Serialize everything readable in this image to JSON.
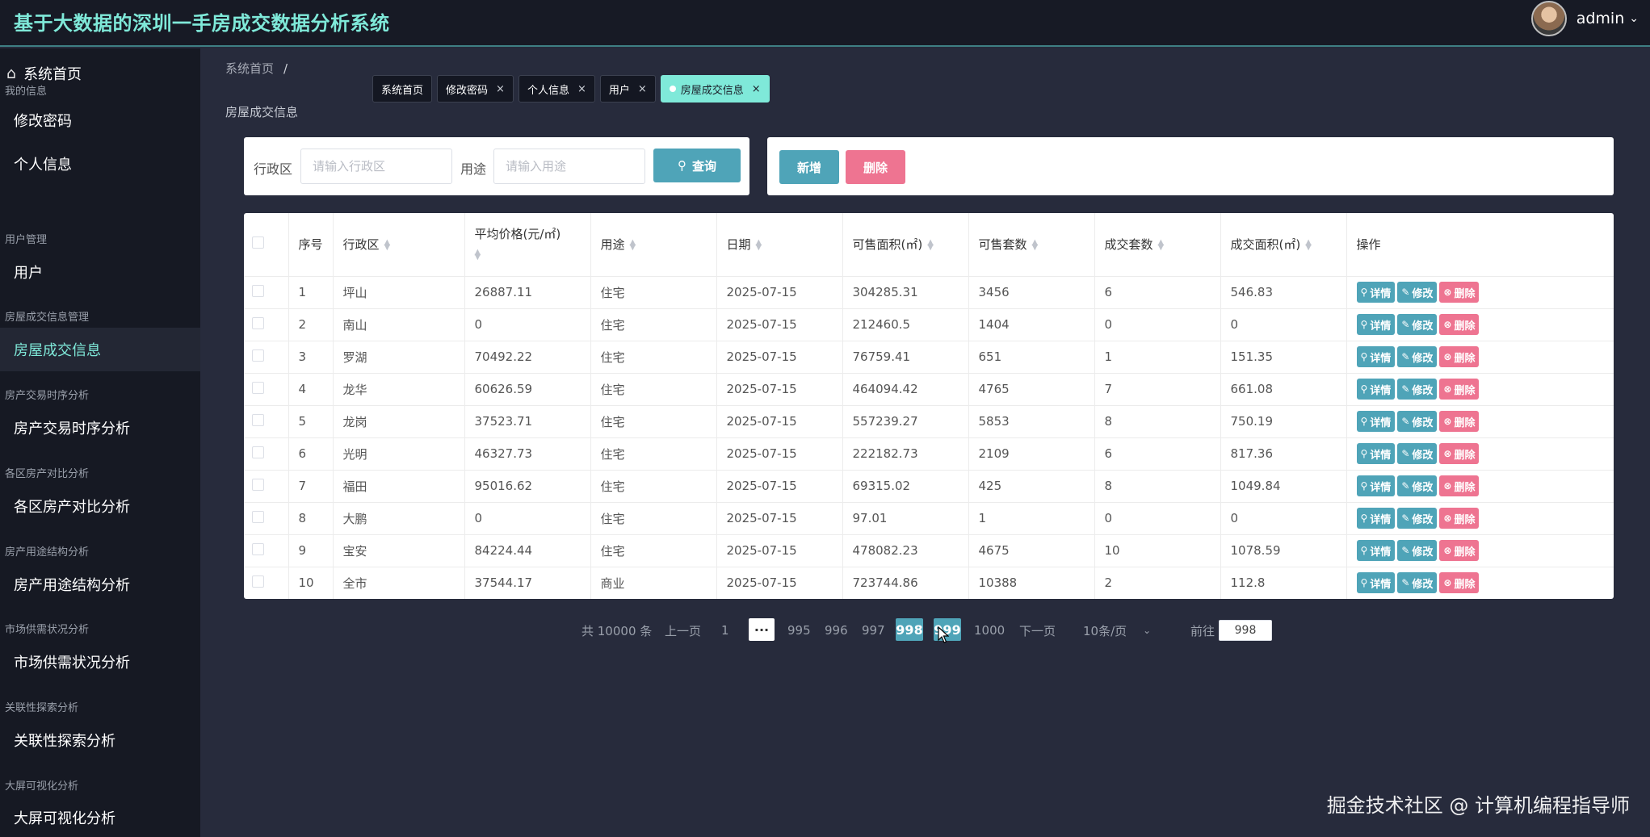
{
  "header": {
    "title": "基于大数据的深圳一手房成交数据分析系统",
    "user": "admin"
  },
  "sidebar": {
    "home": "系统首页",
    "groups": [
      {
        "title": "我的信息",
        "items": [
          "修改密码",
          "个人信息"
        ]
      },
      {
        "title": "用户管理",
        "items": [
          "用户"
        ]
      },
      {
        "title": "房屋成交信息管理",
        "items": [
          "房屋成交信息"
        ]
      },
      {
        "title": "房产交易时序分析",
        "items": [
          "房产交易时序分析"
        ]
      },
      {
        "title": "各区房产对比分析",
        "items": [
          "各区房产对比分析"
        ]
      },
      {
        "title": "房产用途结构分析",
        "items": [
          "房产用途结构分析"
        ]
      },
      {
        "title": "市场供需状况分析",
        "items": [
          "市场供需状况分析"
        ]
      },
      {
        "title": "关联性探索分析",
        "items": [
          "关联性探索分析"
        ]
      },
      {
        "title": "大屏可视化分析",
        "items": [
          "大屏可视化分析"
        ]
      }
    ],
    "active": "房屋成交信息"
  },
  "breadcrumb": {
    "home": "系统首页",
    "sep": "/"
  },
  "page_label": "房屋成交信息",
  "tabs": [
    {
      "label": "系统首页",
      "closable": false
    },
    {
      "label": "修改密码",
      "closable": true
    },
    {
      "label": "个人信息",
      "closable": true
    },
    {
      "label": "用户",
      "closable": true
    },
    {
      "label": "房屋成交信息",
      "closable": true,
      "active": true
    }
  ],
  "tab_close": "×",
  "search": {
    "district_label": "行政区",
    "district_placeholder": "请输入行政区",
    "usage_label": "用途",
    "usage_placeholder": "请输入用途",
    "search_button": "查询"
  },
  "actions": {
    "add": "新增",
    "delete": "删除"
  },
  "table": {
    "columns": [
      "序号",
      "行政区",
      "平均价格(元/㎡)",
      "用途",
      "日期",
      "可售面积(㎡)",
      "可售套数",
      "成交套数",
      "成交面积(㎡)",
      "操作"
    ],
    "row_actions": {
      "detail": "详情",
      "edit": "修改",
      "delete": "删除"
    },
    "rows": [
      [
        "1",
        "坪山",
        "26887.11",
        "住宅",
        "2025-07-15",
        "304285.31",
        "3456",
        "6",
        "546.83"
      ],
      [
        "2",
        "南山",
        "0",
        "住宅",
        "2025-07-15",
        "212460.5",
        "1404",
        "0",
        "0"
      ],
      [
        "3",
        "罗湖",
        "70492.22",
        "住宅",
        "2025-07-15",
        "76759.41",
        "651",
        "1",
        "151.35"
      ],
      [
        "4",
        "龙华",
        "60626.59",
        "住宅",
        "2025-07-15",
        "464094.42",
        "4765",
        "7",
        "661.08"
      ],
      [
        "5",
        "龙岗",
        "37523.71",
        "住宅",
        "2025-07-15",
        "557239.27",
        "5853",
        "8",
        "750.19"
      ],
      [
        "6",
        "光明",
        "46327.73",
        "住宅",
        "2025-07-15",
        "222182.73",
        "2109",
        "6",
        "817.36"
      ],
      [
        "7",
        "福田",
        "95016.62",
        "住宅",
        "2025-07-15",
        "69315.02",
        "425",
        "8",
        "1049.84"
      ],
      [
        "8",
        "大鹏",
        "0",
        "住宅",
        "2025-07-15",
        "97.01",
        "1",
        "0",
        "0"
      ],
      [
        "9",
        "宝安",
        "84224.44",
        "住宅",
        "2025-07-15",
        "478082.23",
        "4675",
        "10",
        "1078.59"
      ],
      [
        "10",
        "全市",
        "37544.17",
        "商业",
        "2025-07-15",
        "723744.86",
        "10388",
        "2",
        "112.8"
      ]
    ]
  },
  "pagination": {
    "total": "共 10000 条",
    "prev": "上一页",
    "first": "1",
    "ellipsis": "···",
    "pages": [
      "995",
      "996",
      "997",
      "998",
      "999",
      "1000"
    ],
    "current": "998",
    "next": "下一页",
    "page_size": "10条/页",
    "goto_label": "前往",
    "goto_value": "998"
  },
  "watermark": "掘金技术社区 @ 计算机编程指导师"
}
